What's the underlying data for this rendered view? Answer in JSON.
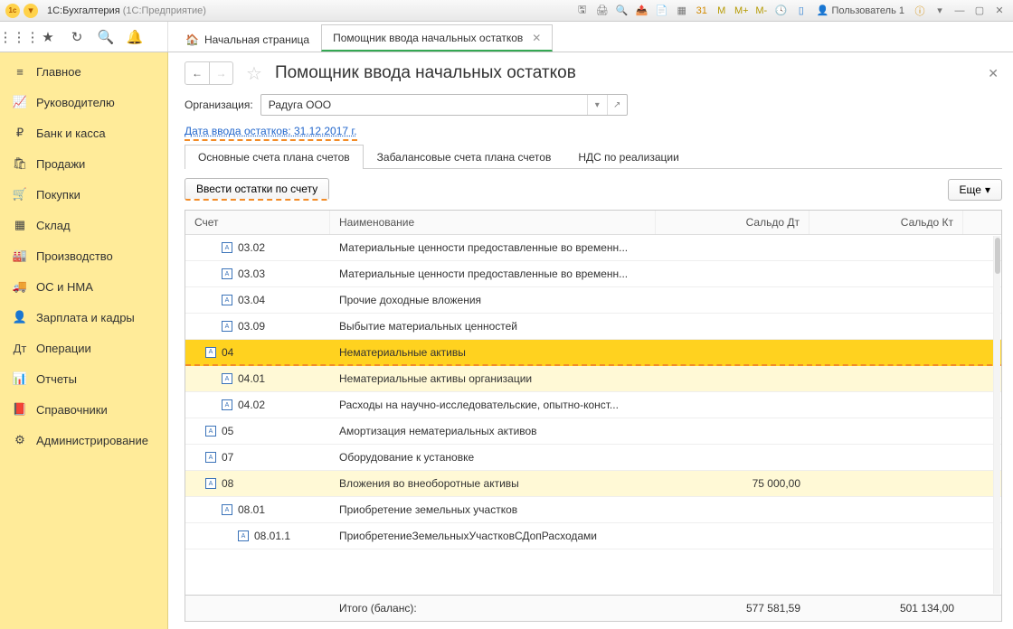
{
  "titlebar": {
    "app_title": "1С:Бухгалтерия",
    "app_subtitle": "(1С:Предприятие)",
    "user": "Пользователь 1",
    "icons_m": [
      "M",
      "M+",
      "M-"
    ]
  },
  "toolstrip": {
    "tab_home": "Начальная страница",
    "tab_active": "Помощник ввода начальных остатков"
  },
  "sidebar": {
    "items": [
      {
        "icon": "≡",
        "label": "Главное"
      },
      {
        "icon": "📈",
        "label": "Руководителю"
      },
      {
        "icon": "₽",
        "label": "Банк и касса"
      },
      {
        "icon": "🛍",
        "label": "Продажи"
      },
      {
        "icon": "🛒",
        "label": "Покупки"
      },
      {
        "icon": "▦",
        "label": "Склад"
      },
      {
        "icon": "🏭",
        "label": "Производство"
      },
      {
        "icon": "🚚",
        "label": "ОС и НМА"
      },
      {
        "icon": "👤",
        "label": "Зарплата и кадры"
      },
      {
        "icon": "Дт",
        "label": "Операции"
      },
      {
        "icon": "📊",
        "label": "Отчеты"
      },
      {
        "icon": "📕",
        "label": "Справочники"
      },
      {
        "icon": "⚙",
        "label": "Администрирование"
      }
    ]
  },
  "page": {
    "title": "Помощник ввода начальных остатков",
    "org_label": "Организация:",
    "org_value": "Радуга ООО",
    "date_link": "Дата ввода остатков: 31.12.2017 г."
  },
  "inner_tabs": {
    "t0": "Основные счета плана счетов",
    "t1": "Забалансовые счета плана счетов",
    "t2": "НДС по реализации"
  },
  "actions": {
    "enter_balance": "Ввести остатки по счету",
    "more": "Еще"
  },
  "table": {
    "col_account": "Счет",
    "col_name": "Наименование",
    "col_dt": "Сальдо Дт",
    "col_kt": "Сальдо Кт",
    "rows": [
      {
        "acc": "03.02",
        "lvl": 1,
        "name": "Материальные ценности предоставленные во временн...",
        "dt": "",
        "kt": ""
      },
      {
        "acc": "03.03",
        "lvl": 1,
        "name": "Материальные ценности предоставленные во временн...",
        "dt": "",
        "kt": ""
      },
      {
        "acc": "03.04",
        "lvl": 1,
        "name": "Прочие доходные вложения",
        "dt": "",
        "kt": ""
      },
      {
        "acc": "03.09",
        "lvl": 1,
        "name": "Выбытие материальных ценностей",
        "dt": "",
        "kt": ""
      },
      {
        "acc": "04",
        "lvl": 0,
        "name": "Нематериальные активы",
        "dt": "",
        "kt": "",
        "selected": true
      },
      {
        "acc": "04.01",
        "lvl": 1,
        "name": "Нематериальные активы организации",
        "dt": "",
        "kt": ""
      },
      {
        "acc": "04.02",
        "lvl": 1,
        "name": "Расходы на научно-исследовательские, опытно-конст...",
        "dt": "",
        "kt": ""
      },
      {
        "acc": "05",
        "lvl": 0,
        "name": "Амортизация нематериальных активов",
        "dt": "",
        "kt": ""
      },
      {
        "acc": "07",
        "lvl": 0,
        "name": "Оборудование к установке",
        "dt": "",
        "kt": ""
      },
      {
        "acc": "08",
        "lvl": 0,
        "name": "Вложения во внеоборотные активы",
        "dt": "75 000,00",
        "kt": "",
        "shade": true
      },
      {
        "acc": "08.01",
        "lvl": 1,
        "name": "Приобретение земельных участков",
        "dt": "",
        "kt": ""
      },
      {
        "acc": "08.01.1",
        "lvl": 2,
        "name": "ПриобретениеЗемельныхУчастковСДопРасходами",
        "dt": "",
        "kt": ""
      }
    ],
    "footer_label": "Итого (баланс):",
    "footer_dt": "577 581,59",
    "footer_kt": "501 134,00"
  }
}
